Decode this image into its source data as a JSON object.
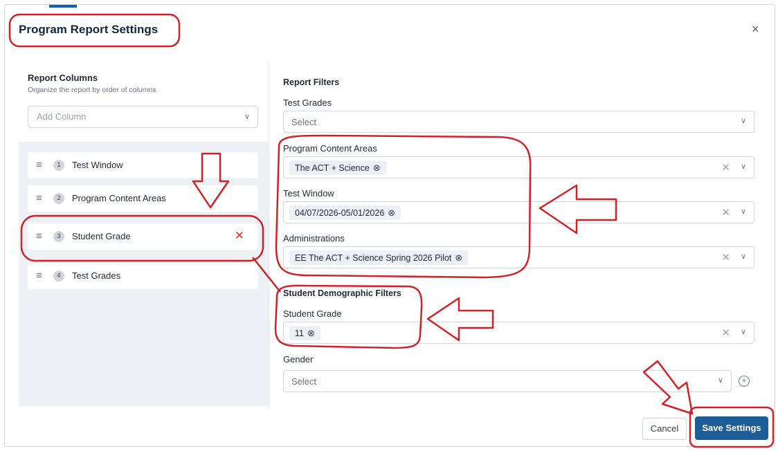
{
  "dialog": {
    "title": "Program Report Settings",
    "close_icon": "×"
  },
  "report_columns": {
    "heading": "Report Columns",
    "subtitle": "Organize the report by order of columns",
    "add_column_placeholder": "Add Column",
    "items": [
      {
        "index": "1",
        "label": "Test Window"
      },
      {
        "index": "2",
        "label": "Program Content Areas"
      },
      {
        "index": "3",
        "label": "Student Grade",
        "remove_icon": "✕"
      },
      {
        "index": "4",
        "label": "Test Grades"
      }
    ]
  },
  "report_filters": {
    "heading": "Report Filters",
    "test_grades": {
      "label": "Test Grades",
      "placeholder": "Select"
    },
    "program_content_areas": {
      "label": "Program Content Areas",
      "chip": "The ACT + Science"
    },
    "test_window": {
      "label": "Test Window",
      "chip": "04/07/2026-05/01/2026"
    },
    "administrations": {
      "label": "Administrations",
      "chip": "EE The ACT + Science Spring 2026 Pilot"
    }
  },
  "demographic_filters": {
    "heading": "Student Demographic Filters",
    "student_grade": {
      "label": "Student Grade",
      "chip": "11"
    },
    "gender": {
      "label": "Gender",
      "placeholder": "Select"
    }
  },
  "footer": {
    "cancel_label": "Cancel",
    "save_label": "Save Settings"
  },
  "icons": {
    "grip": "≡",
    "chevron": "∨",
    "clear": "✕",
    "chip_remove": "⊗",
    "add": "+"
  },
  "colors": {
    "primary": "#1d5e98",
    "danger": "#e3342f",
    "annotation": "#d32026",
    "panel_bg": "#edf1f5"
  }
}
